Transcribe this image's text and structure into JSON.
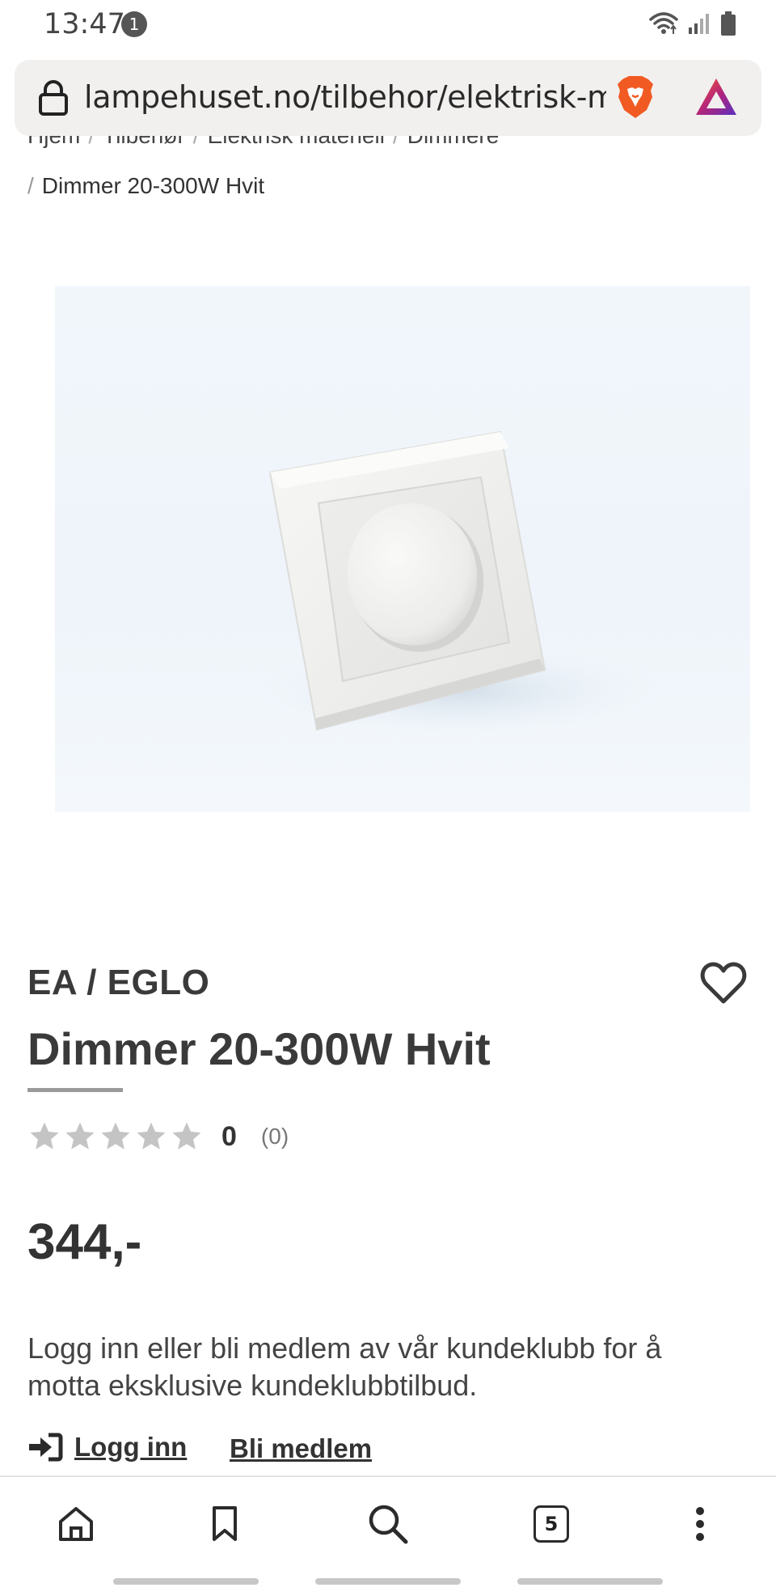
{
  "status_bar": {
    "time": "13:47",
    "notification_count": "1",
    "icons": [
      "wifi-icon",
      "signal-icon",
      "battery-icon"
    ]
  },
  "browser": {
    "url": "lampehuset.no/tilbehor/elektrisk-m",
    "icons": [
      "lock-icon",
      "brave-shield-icon",
      "brave-rewards-icon"
    ]
  },
  "breadcrumb": {
    "items": [
      "Hjem",
      "Tilbehør",
      "Elektrisk materiell",
      "Dimmere"
    ],
    "current": "Dimmer 20-300W Hvit",
    "separator": "/"
  },
  "product": {
    "image_alt": "Dimmer 20-300W Hvit",
    "brand": "EA / EGLO",
    "title": "Dimmer 20-300W Hvit",
    "rating_value": "0",
    "rating_count": "(0)",
    "rating_stars": 0,
    "price": "344,-"
  },
  "club": {
    "text": "Logg inn eller bli medlem av vår kundeklubb for å motta eksklusive kundeklubbtilbud.",
    "login_label": "Logg inn",
    "member_label": "Bli medlem"
  },
  "bottom_nav": {
    "items": [
      "home-icon",
      "bookmark-icon",
      "search-icon",
      "tabs-icon",
      "more-icon"
    ],
    "tab_count": "5"
  },
  "colors": {
    "text": "#3c3c3c",
    "star_empty": "#c4c4c4",
    "url_bar_bg": "#f1f0ef",
    "brave_orange": "#f15a22"
  }
}
